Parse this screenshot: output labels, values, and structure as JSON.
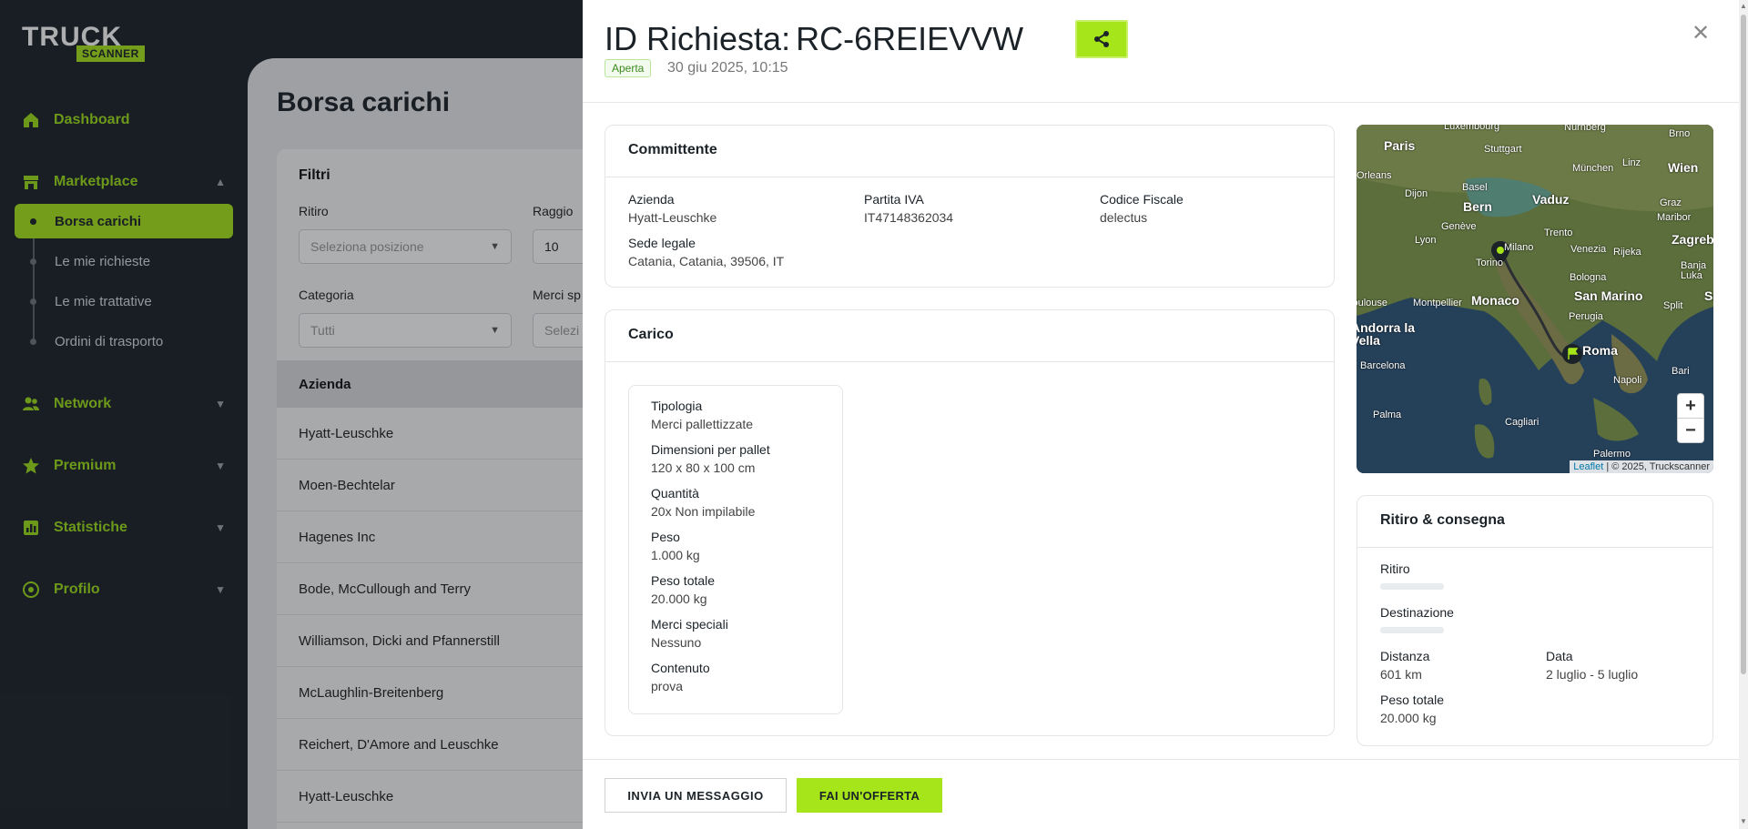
{
  "brand": {
    "line1": "TRUCK",
    "line2": "SCANNER"
  },
  "sidebar": {
    "dashboard": "Dashboard",
    "marketplace": "Marketplace",
    "sub_items": [
      "Borsa carichi",
      "Le mie richieste",
      "Le mie trattative",
      "Ordini di trasporto"
    ],
    "network": "Network",
    "premium": "Premium",
    "statistiche": "Statistiche",
    "profilo": "Profilo"
  },
  "background": {
    "title": "Borsa carichi",
    "filters_title": "Filtri",
    "ritiro_label": "Ritiro",
    "ritiro_placeholder": "Seleziona posizione",
    "raggio_label": "Raggio",
    "raggio_value": "10",
    "categoria_label": "Categoria",
    "categoria_value": "Tutti",
    "merci_label": "Merci sp",
    "merci_placeholder": "Selezi",
    "table_header": "Azienda",
    "rows": [
      "Hyatt-Leuschke",
      "Moen-Bechtelar",
      "Hagenes Inc",
      "Bode, McCullough and Terry",
      "Williamson, Dicki and Pfannerstill",
      "McLaughlin-Breitenberg",
      "Reichert, D'Amore and Leuschke",
      "Hyatt-Leuschke"
    ]
  },
  "panel": {
    "title_label": "ID Richiesta:",
    "request_id": "RC-6REIEVVW",
    "status": "Aperta",
    "date": "30 giu 2025, 10:15",
    "committente": {
      "title": "Committente",
      "azienda_label": "Azienda",
      "azienda_value": "Hyatt-Leuschke",
      "piva_label": "Partita IVA",
      "piva_value": "IT47148362034",
      "cf_label": "Codice Fiscale",
      "cf_value": "delectus",
      "sede_label": "Sede legale",
      "sede_value": "Catania, Catania, 39506, IT"
    },
    "carico": {
      "title": "Carico",
      "items": [
        {
          "label": "Tipologia",
          "value": "Merci pallettizzate"
        },
        {
          "label": "Dimensioni per pallet",
          "value": "120 x 80 x 100 cm"
        },
        {
          "label": "Quantità",
          "value": "20x Non impilabile"
        },
        {
          "label": "Peso",
          "value": "1.000 kg"
        },
        {
          "label": "Peso totale",
          "value": "20.000 kg"
        },
        {
          "label": "Merci speciali",
          "value": "Nessuno"
        },
        {
          "label": "Contenuto",
          "value": "prova"
        }
      ]
    },
    "map": {
      "cities": [
        "Luxembourg",
        "Nürnberg",
        "Brno",
        "Paris",
        "Stuttgart",
        "Linz",
        "Wien",
        "München",
        "Orleans",
        "Dijon",
        "Basel",
        "Bern",
        "Vaduz",
        "Graz",
        "Maribor",
        "Genève",
        "Zagreb",
        "Lyon",
        "Milano",
        "Venezia",
        "Rijeka",
        "Torino",
        "Trento",
        "Bologna",
        "Banja Luka",
        "Toulouse",
        "Montpellier",
        "Monaco",
        "San Marino",
        "Split",
        "Sa",
        "Perugia",
        "Andorra la Vella",
        "Roma",
        "Barcelona",
        "Bari",
        "Napoli",
        "Palma",
        "Cagliari",
        "Palermo"
      ],
      "zoom_in": "+",
      "zoom_out": "−",
      "attribution_link": "Leaflet",
      "attribution_text": "| © 2025, Truckscanner"
    },
    "ritiro": {
      "title": "Ritiro & consegna",
      "ritiro_label": "Ritiro",
      "destinazione_label": "Destinazione",
      "distanza_label": "Distanza",
      "distanza_value": "601 km",
      "data_label": "Data",
      "data_value": "2 luglio - 5 luglio",
      "peso_label": "Peso totale",
      "peso_value": "20.000 kg"
    },
    "actions": {
      "message": "INVIA UN MESSAGGIO",
      "offer": "FAI UN'OFFERTA"
    }
  },
  "colors": {
    "accent": "#a6e51a",
    "sidebar_bg": "#1b2228",
    "status_green": "#3a8a1e"
  }
}
